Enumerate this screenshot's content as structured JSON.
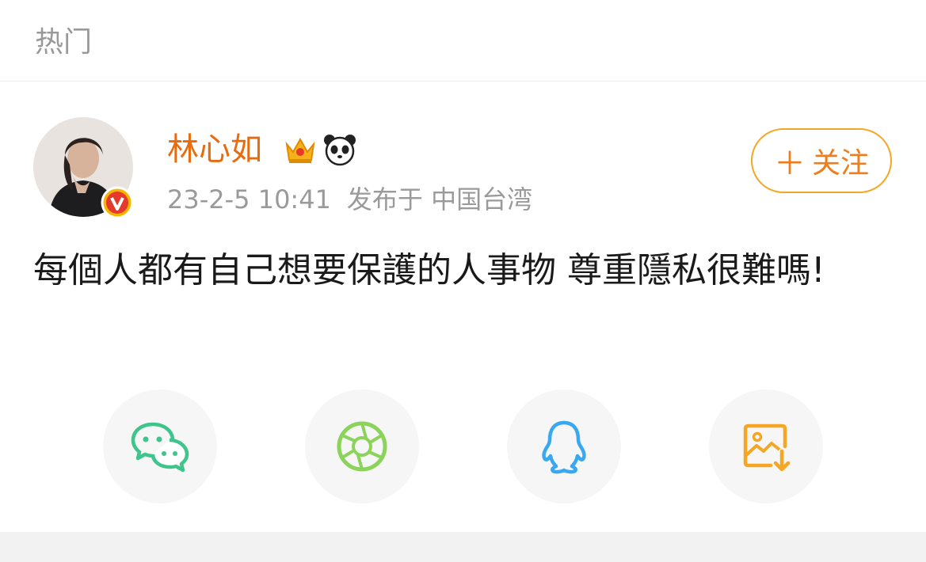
{
  "header": {
    "tab_label": "热门"
  },
  "post": {
    "username": "林心如",
    "timestamp": "23-2-5 10:41",
    "location": "发布于 中国台湾",
    "follow_label": "关注",
    "follow_plus": "＋",
    "text": "每個人都有自己想要保護的人事物 尊重隱私很難嗎!"
  },
  "icons": {
    "verified": "verified-v-icon",
    "crown": "crown-badge-icon",
    "panda": "panda-badge-icon"
  },
  "share": [
    {
      "icon": "wechat-icon",
      "color": "#3fc48c"
    },
    {
      "icon": "moments-icon",
      "color": "#8bd35b"
    },
    {
      "icon": "qq-icon",
      "color": "#3aa8ef"
    },
    {
      "icon": "save-image-icon",
      "color": "#f5a623"
    }
  ]
}
